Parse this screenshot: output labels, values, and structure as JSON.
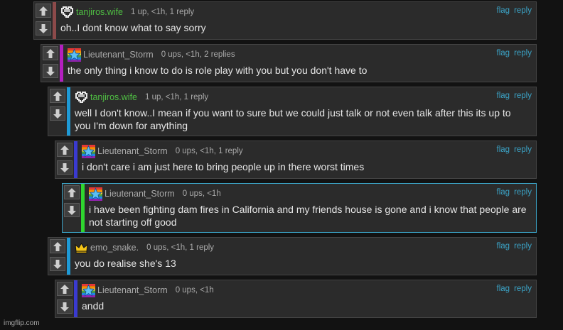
{
  "actions": {
    "flag_label": "flag",
    "reply_label": "reply"
  },
  "comments": [
    {
      "username": "tanjiros.wife",
      "username_color": "#4fbf43",
      "avatar_icon": "pixel-heart-icon",
      "stats": "1 up, <1h, 1 reply",
      "text": "oh..I dont know what to say sorry",
      "bar_color": "#8c4a4a"
    },
    {
      "username": "Lieutenant_Storm",
      "username_color": "#aaaaaa",
      "avatar_icon": "pride-star-icon",
      "stats": "0 ups, <1h, 2 replies",
      "text": "the only thing i know to do is role play with you but you don't have to",
      "bar_color": "#b31fbf"
    },
    {
      "username": "tanjiros.wife",
      "username_color": "#4fbf43",
      "avatar_icon": "pixel-heart-icon",
      "stats": "1 up, <1h, 1 reply",
      "text": "well I don't know..I mean if you want to sure but we could just talk or not even talk after this its up to you I'm down for anything",
      "bar_color": "#1e9ad6"
    },
    {
      "username": "Lieutenant_Storm",
      "username_color": "#aaaaaa",
      "avatar_icon": "pride-star-icon",
      "stats": "0 ups, <1h, 1 reply",
      "text": "i don't care i am just here to bring people up in there worst times",
      "bar_color": "#3a3ad0"
    },
    {
      "username": "Lieutenant_Storm",
      "username_color": "#aaaaaa",
      "avatar_icon": "pride-star-icon",
      "stats": "0 ups, <1h",
      "text": "i have been fighting dam fires in California and my friends house is gone and i know that people are not starting off good",
      "bar_color": "#2fd62f"
    },
    {
      "username": "emo_snake.",
      "username_color": "#aaaaaa",
      "avatar_icon": "crown-icon",
      "stats": "0 ups, <1h, 1 reply",
      "text": "you do realise she's 13",
      "bar_color": "#1e9ad6"
    },
    {
      "username": "Lieutenant_Storm",
      "username_color": "#aaaaaa",
      "avatar_icon": "pride-star-icon",
      "stats": "0 ups, <1h",
      "text": "andd",
      "bar_color": "#3a3ad0"
    }
  ],
  "watermark": "imgflip.com"
}
